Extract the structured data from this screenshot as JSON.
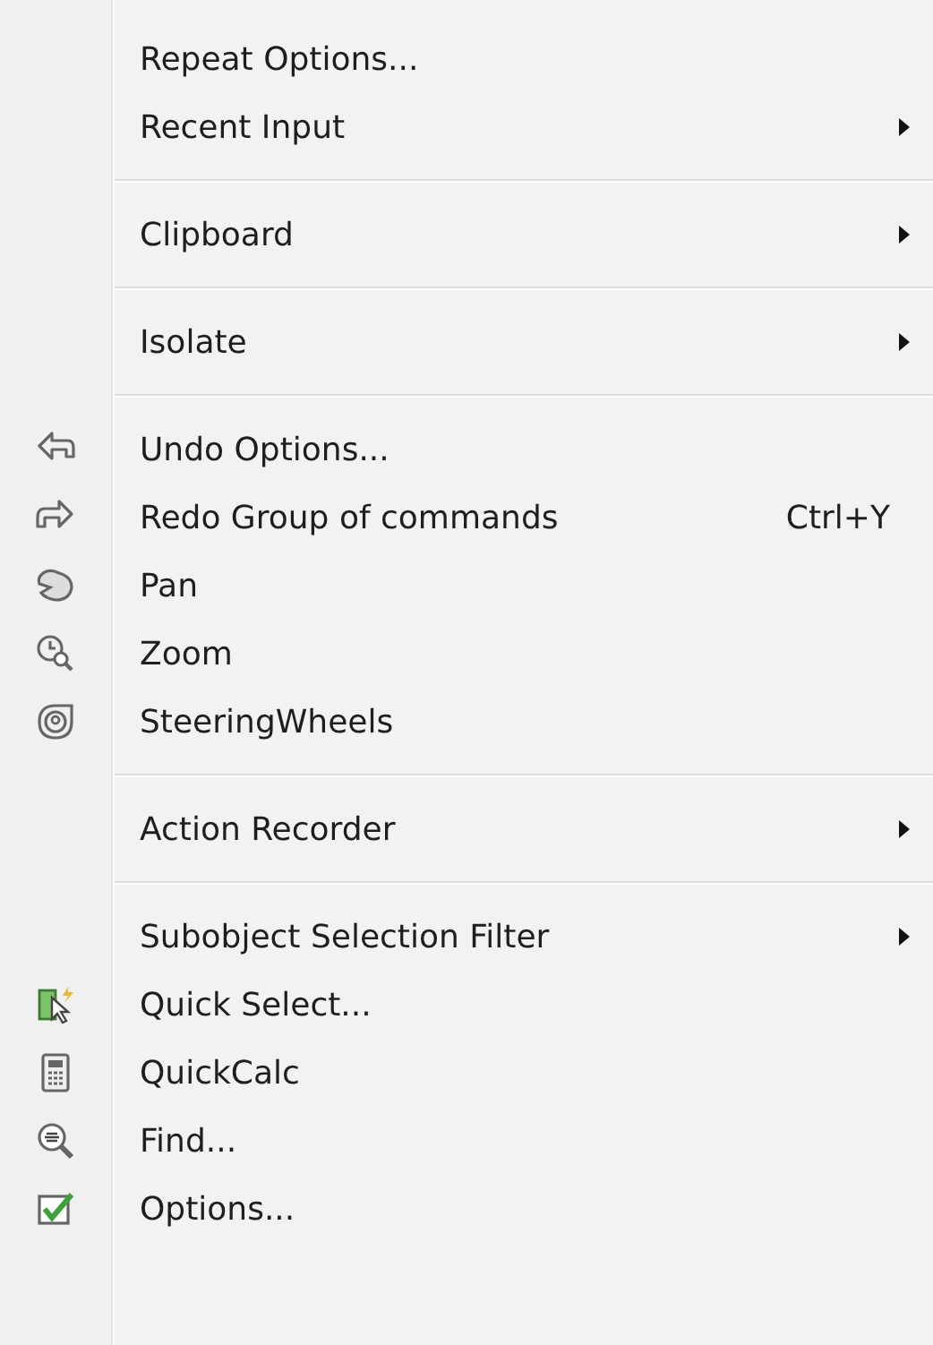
{
  "menu": {
    "items": [
      {
        "kind": "item",
        "label": "Repeat Options...",
        "submenu": false
      },
      {
        "kind": "item",
        "label": "Recent Input",
        "submenu": true
      },
      {
        "kind": "separator"
      },
      {
        "kind": "item",
        "label": "Clipboard",
        "submenu": true
      },
      {
        "kind": "separator"
      },
      {
        "kind": "item",
        "label": "Isolate",
        "submenu": true
      },
      {
        "kind": "separator"
      },
      {
        "kind": "item",
        "label": "Undo Options...",
        "submenu": false
      },
      {
        "kind": "item",
        "label": "Redo Group of commands",
        "shortcut": "Ctrl+Y",
        "submenu": false
      },
      {
        "kind": "item",
        "label": "Pan",
        "submenu": false
      },
      {
        "kind": "item",
        "label": "Zoom",
        "submenu": false
      },
      {
        "kind": "item",
        "label": "SteeringWheels",
        "submenu": false
      },
      {
        "kind": "separator"
      },
      {
        "kind": "item",
        "label": "Action Recorder",
        "submenu": true
      },
      {
        "kind": "separator"
      },
      {
        "kind": "item",
        "label": "Subobject Selection Filter",
        "submenu": true
      },
      {
        "kind": "item",
        "label": "Quick Select...",
        "submenu": false
      },
      {
        "kind": "item",
        "label": "QuickCalc",
        "submenu": false
      },
      {
        "kind": "item",
        "label": "Find...",
        "submenu": false
      },
      {
        "kind": "item",
        "label": "Options...",
        "submenu": false
      }
    ]
  }
}
